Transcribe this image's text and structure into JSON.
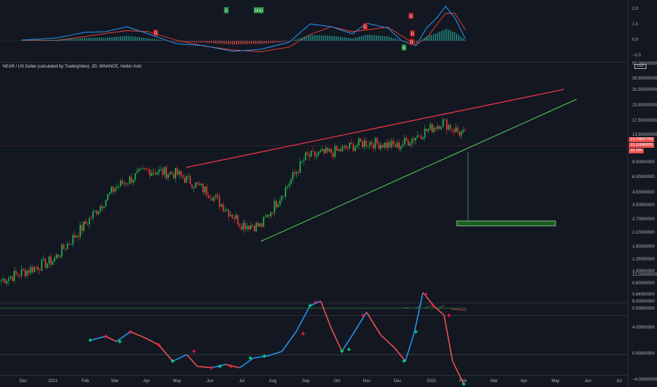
{
  "legend": "NEAR / US Dollar (calculated by TradingView), 2D, BINANCE, Heikin Ashi",
  "colors": {
    "bg": "#131722",
    "up": "#26a69a",
    "down": "#ef5350",
    "upHA": "#22b24c",
    "downHA": "#e53935",
    "resistance": "#f23645",
    "support": "#4caf50",
    "target": "#1b5e20",
    "macd": "#2196f3",
    "signal": "#f44336"
  },
  "time_axis": [
    "Dec",
    "2021",
    "Feb",
    "Mar",
    "Apr",
    "May",
    "Jun",
    "Jul",
    "Aug",
    "Sep",
    "Oct",
    "Nov",
    "Dec",
    "2022",
    "Feb",
    "Mar",
    "Apr",
    "May",
    "Jun",
    "Jul"
  ],
  "price_axis": [
    "52.00000000",
    "39.50000000",
    "31.50000000",
    "23.50000000",
    "17.50000000",
    "13.50000000",
    "8.00000000",
    "6.00000000",
    "4.50000000",
    "3.50000000",
    "2.70000000",
    "2.10000000",
    "1.60000000",
    "1.25000000",
    "1.00000000",
    "0.80000000",
    "0.64000000"
  ],
  "price_tags": {
    "last": "13.70847784",
    "close": "13.11948280",
    "countdown": "1d 19h",
    "usd": "USD"
  },
  "macd_axis": [
    "2.0",
    "1.0",
    "0.0",
    "−1.0"
  ],
  "volume_axis": [
    "0.00000000"
  ],
  "osc_axis": [
    "12.00000000",
    "8.00000000",
    "4.00000000",
    "0.00000000",
    "−4.00000000"
  ],
  "top_markers": [
    {
      "text": "D",
      "color": "green"
    },
    {
      "text": "DDD",
      "color": "green"
    },
    {
      "text": "D",
      "color": "red"
    },
    {
      "text": "D",
      "color": "red"
    },
    {
      "text": "D",
      "color": "red"
    },
    {
      "text": "D",
      "color": "red"
    },
    {
      "text": "D",
      "color": "red"
    },
    {
      "text": "B",
      "color": "green"
    }
  ],
  "chart_data": {
    "type": "candlestick",
    "title": "NEAR / US Dollar (calculated by TradingView), 2D, BINANCE, Heikin Ashi",
    "y_scale": "log",
    "ylim": [
      0.6,
      52
    ],
    "price_path": [
      [
        "Dec 2020",
        0.85
      ],
      [
        "2021",
        1.25
      ],
      [
        "Feb",
        2.5
      ],
      [
        "Mar",
        5.0
      ],
      [
        "Apr",
        7.0
      ],
      [
        "May",
        6.5
      ],
      [
        "Jun",
        4.5
      ],
      [
        "Jul",
        2.5
      ],
      [
        "Aug",
        2.4
      ],
      [
        "Sep",
        9.0
      ],
      [
        "Oct",
        10.0
      ],
      [
        "Nov",
        12.0
      ],
      [
        "Dec",
        11.0
      ],
      [
        "2022",
        17.5
      ],
      [
        "Feb",
        13.2
      ]
    ],
    "resistance_line": [
      [
        "May",
        8.0
      ],
      [
        "May 2022",
        33.0
      ]
    ],
    "support_line": [
      [
        "Jul",
        1.9
      ],
      [
        "Jun 2022",
        25.0
      ]
    ],
    "target_zone": {
      "from": 2.45,
      "to": 2.65
    },
    "last_price": 13.1194828,
    "oscillator_range": [
      -4,
      12
    ]
  }
}
